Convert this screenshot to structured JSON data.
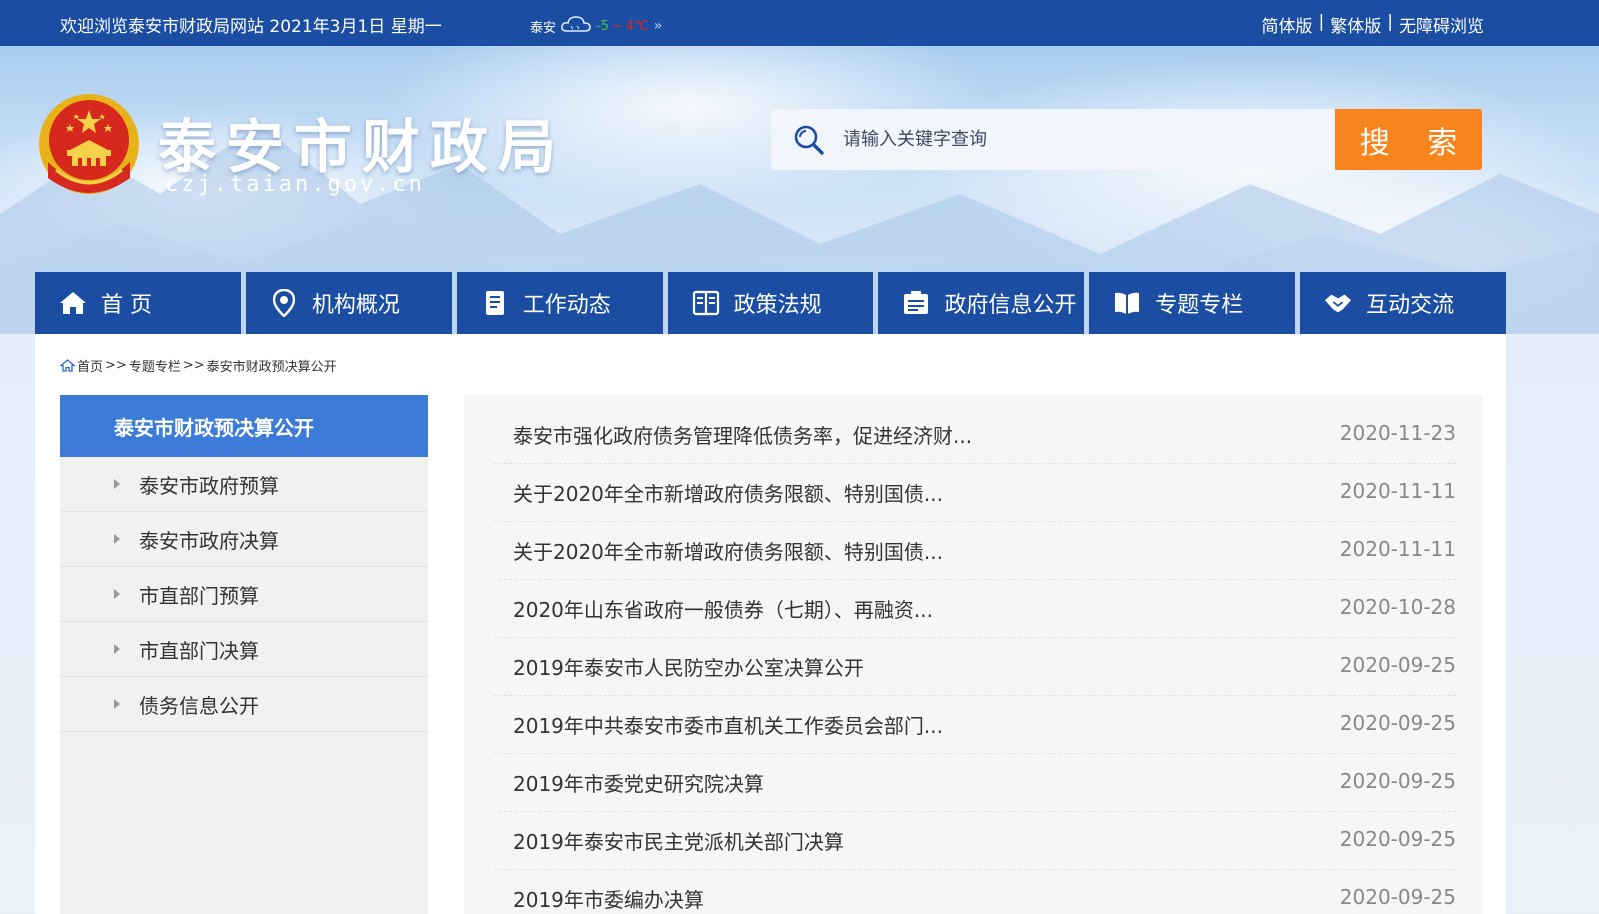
{
  "topbar": {
    "welcome": "欢迎浏览泰安市财政局网站  2021年3月1日 星期一",
    "weather_city": "泰安",
    "weather_low": "-5",
    "weather_sep": "~",
    "weather_high": "4℃",
    "weather_more": "»",
    "links": [
      "简体版",
      "繁体版",
      "无障碍浏览"
    ],
    "link_sep": "|"
  },
  "header": {
    "title": "泰安市财政局",
    "domain": "czj.taian.gov.cn"
  },
  "search": {
    "placeholder": "请输入关键字查询",
    "button": "搜 索"
  },
  "nav": {
    "items": [
      {
        "label": "首 页",
        "icon": "home-icon"
      },
      {
        "label": "机构概况",
        "icon": "location-icon"
      },
      {
        "label": "工作动态",
        "icon": "document-icon"
      },
      {
        "label": "政策法规",
        "icon": "book-icon"
      },
      {
        "label": "政府信息公开",
        "icon": "info-board-icon"
      },
      {
        "label": "专题专栏",
        "icon": "open-book-icon"
      },
      {
        "label": "互动交流",
        "icon": "handshake-icon"
      }
    ]
  },
  "breadcrumb": {
    "items": [
      "首页",
      "专题专栏",
      "泰安市财政预决算公开"
    ],
    "sep": ">>"
  },
  "sidebar": {
    "heading": "泰安市财政预决算公开",
    "items": [
      "泰安市政府预算",
      "泰安市政府决算",
      "市直部门预算",
      "市直部门决算",
      "债务信息公开"
    ]
  },
  "articles": [
    {
      "title": "泰安市强化政府债务管理降低债务率，促进经济财...",
      "date": "2020-11-23"
    },
    {
      "title": "关于2020年全市新增政府债务限额、特别国债...",
      "date": "2020-11-11"
    },
    {
      "title": "关于2020年全市新增政府债务限额、特别国债...",
      "date": "2020-11-11"
    },
    {
      "title": "2020年山东省政府一般债券（七期）、再融资...",
      "date": "2020-10-28"
    },
    {
      "title": "2019年泰安市人民防空办公室决算公开",
      "date": "2020-09-25"
    },
    {
      "title": "2019年中共泰安市委市直机关工作委员会部门...",
      "date": "2020-09-25"
    },
    {
      "title": "2019年市委党史研究院决算",
      "date": "2020-09-25"
    },
    {
      "title": "2019年泰安市民主党派机关部门决算",
      "date": "2020-09-25"
    },
    {
      "title": "2019年市委编办决算",
      "date": "2020-09-25"
    }
  ],
  "colors": {
    "primary_blue": "#1b4ea2",
    "sidebar_active": "#3c7bd8",
    "search_button": "#f7841c"
  }
}
